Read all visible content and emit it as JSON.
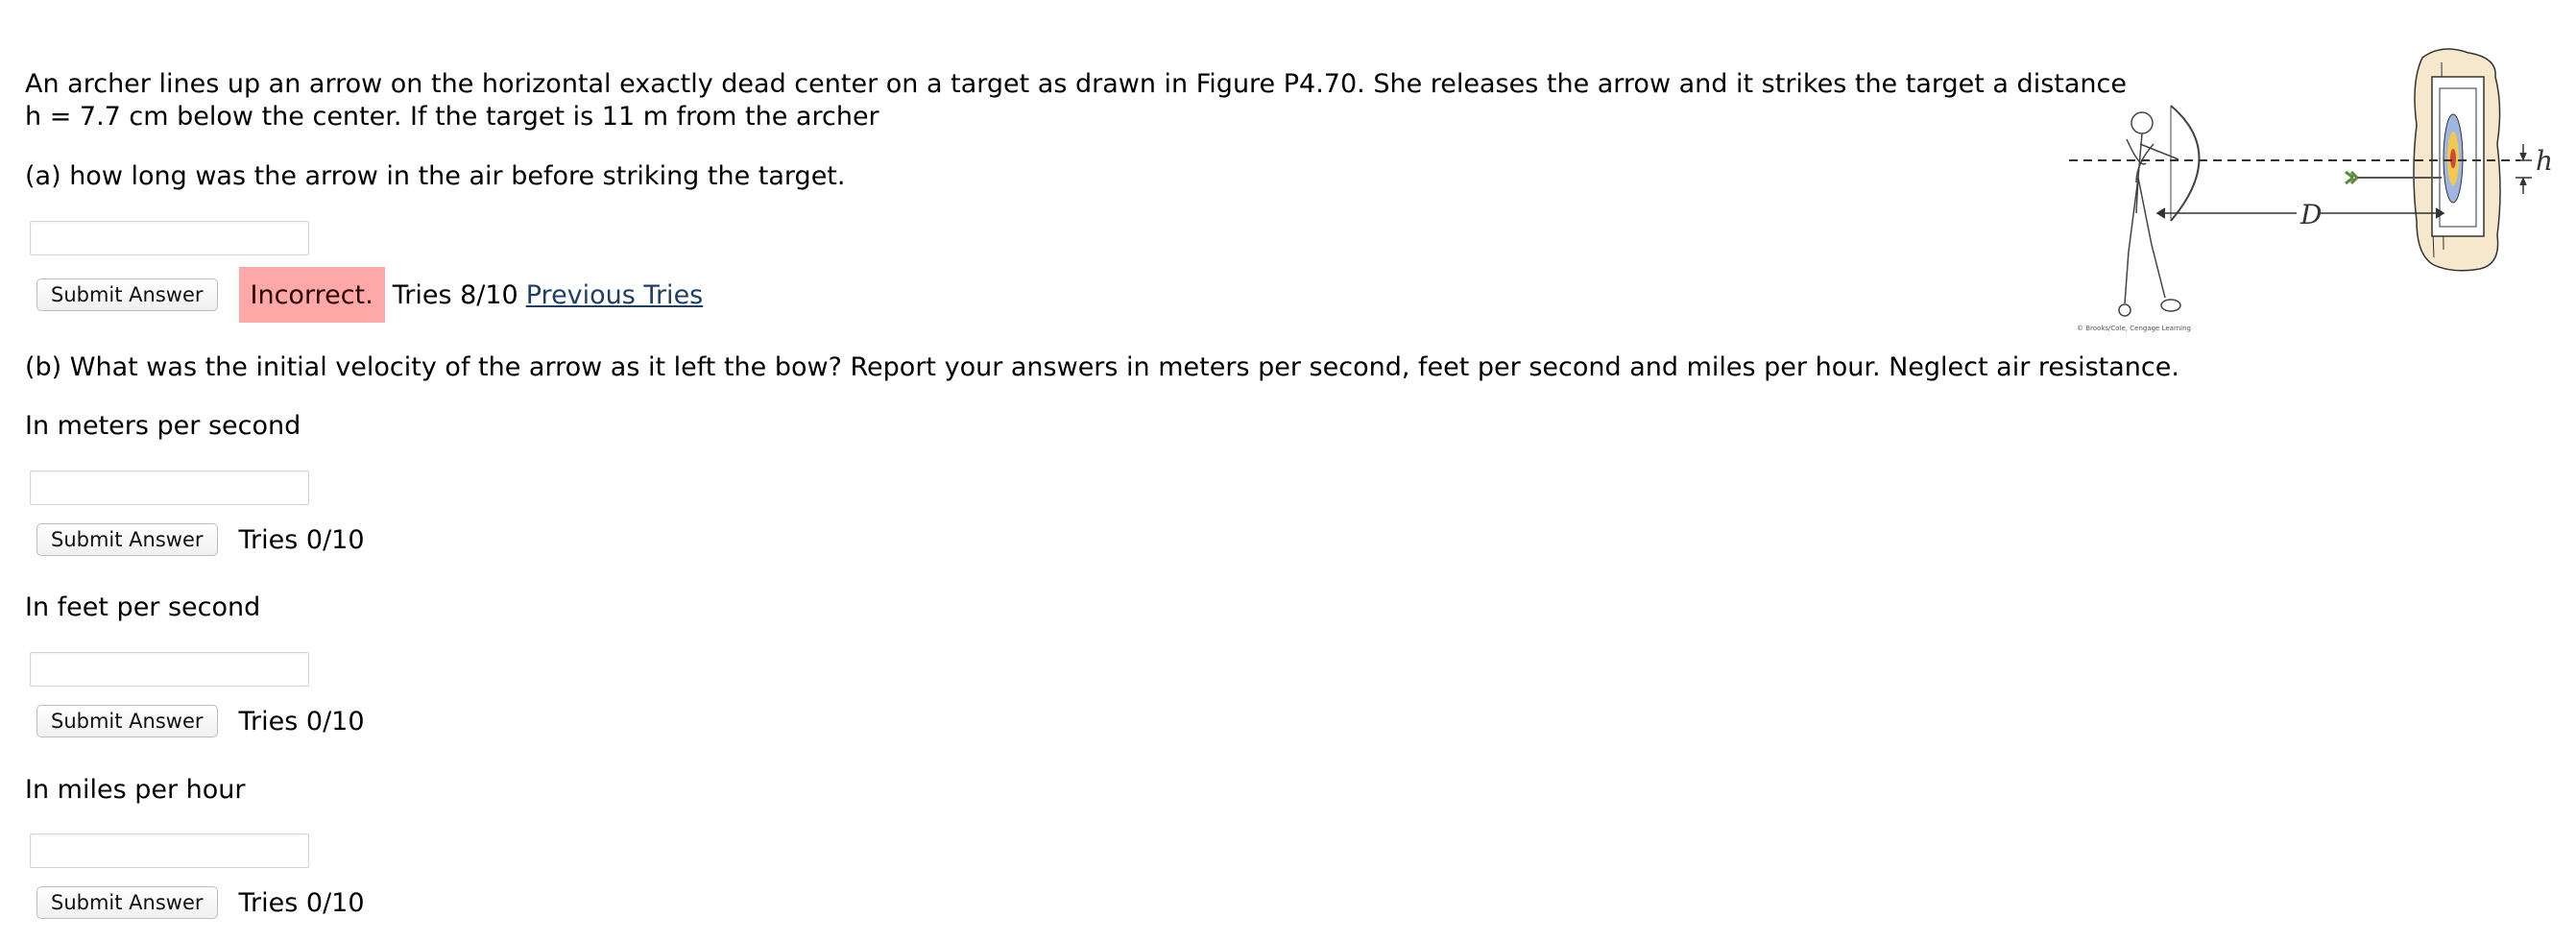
{
  "problem": {
    "intro_line1": "An archer lines up an arrow on the horizontal exactly dead center on a target as drawn in Figure P4.70. She releases the arrow and it strikes the target a distance",
    "intro_line2": "h = 7.7 cm below the center. If the target is 11 m from the archer",
    "part_a": "(a) how long was the arrow in the air before striking the target.",
    "part_b": "(b) What was the initial velocity of the arrow as it left the bow? Report your answers in meters per second, feet per second and miles per hour. Neglect air resistance."
  },
  "answers": {
    "a": {
      "value": "",
      "submit_label": "Submit Answer",
      "status": "Incorrect.",
      "tries": "Tries 8/10",
      "previous_tries": "Previous Tries"
    },
    "mps": {
      "label": "In meters per second",
      "value": "",
      "submit_label": "Submit Answer",
      "tries": "Tries 0/10"
    },
    "fps": {
      "label": "In feet per second",
      "value": "",
      "submit_label": "Submit Answer",
      "tries": "Tries 0/10"
    },
    "mph": {
      "label": "In miles per hour",
      "value": "",
      "submit_label": "Submit Answer",
      "tries": "Tries 0/10"
    }
  },
  "figure": {
    "label_h": "h",
    "label_d": "D",
    "credit": "© Brooks/Cole, Cengage Learning"
  }
}
